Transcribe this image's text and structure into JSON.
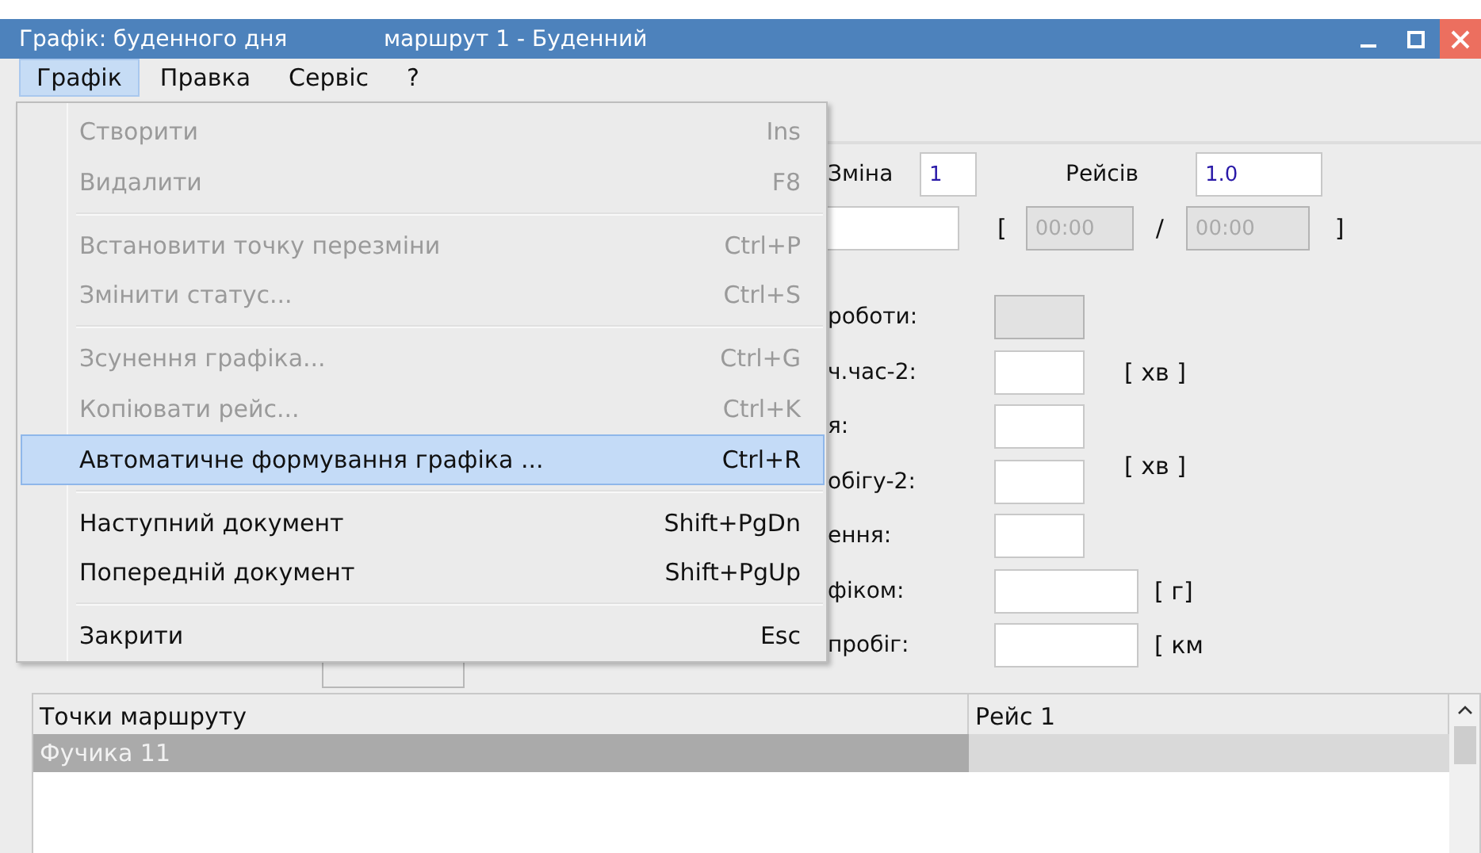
{
  "window": {
    "title": "Графік: буденного дня",
    "subtitle": "маршрут 1 - Буденний"
  },
  "menu_bar": [
    {
      "label": "Графік",
      "selected": true
    },
    {
      "label": "Правка",
      "selected": false
    },
    {
      "label": "Сервіс",
      "selected": false
    },
    {
      "label": "?",
      "selected": false
    }
  ],
  "menu": {
    "groups": [
      [
        {
          "label": "Створити",
          "shortcut": "Ins",
          "disabled": true,
          "selected": false
        },
        {
          "label": "Видалити",
          "shortcut": "F8",
          "disabled": true,
          "selected": false
        }
      ],
      [
        {
          "label": "Встановити точку перезміни",
          "shortcut": "Ctrl+P",
          "disabled": true,
          "selected": false
        },
        {
          "label": "Змінити статус...",
          "shortcut": "Ctrl+S",
          "disabled": true,
          "selected": false
        }
      ],
      [
        {
          "label": "Зсунення графіка...",
          "shortcut": "Ctrl+G",
          "disabled": true,
          "selected": false
        },
        {
          "label": "Копіювати рейс...",
          "shortcut": "Ctrl+K",
          "disabled": true,
          "selected": false
        },
        {
          "label": "Автоматичне формування графіка ...",
          "shortcut": "Ctrl+R",
          "disabled": false,
          "selected": true
        }
      ],
      [
        {
          "label": "Наступний документ",
          "shortcut": "Shift+PgDn",
          "disabled": false,
          "selected": false
        },
        {
          "label": "Попередній документ",
          "shortcut": "Shift+PgUp",
          "disabled": false,
          "selected": false
        }
      ],
      [
        {
          "label": "Закрити",
          "shortcut": "Esc",
          "disabled": false,
          "selected": false
        }
      ]
    ]
  },
  "form": {
    "shift_label": "Зміна",
    "shift_value": "1",
    "trips_label": "Рейсів",
    "trips_value": "1.0",
    "time_open": "[",
    "time_from": "00:00",
    "time_sep": "/",
    "time_to": "00:00",
    "time_close": "]",
    "rows": [
      {
        "label": "роботи:",
        "disabled": true,
        "wide": false,
        "unit": ""
      },
      {
        "label": "ч.час-2:",
        "disabled": false,
        "wide": false,
        "unit": "[ хв ]"
      },
      {
        "label": "я:",
        "disabled": false,
        "wide": false,
        "unit": ""
      },
      {
        "label": "обігу-2:",
        "disabled": false,
        "wide": false,
        "unit": "[ хв ]"
      },
      {
        "label": "ення:",
        "disabled": false,
        "wide": false,
        "unit": ""
      },
      {
        "label": "фіком:",
        "disabled": false,
        "wide": true,
        "unit": "[ г]"
      },
      {
        "label": "пробіг:",
        "disabled": false,
        "wide": true,
        "unit": "[ км"
      }
    ]
  },
  "table": {
    "columns": [
      "Точки маршруту",
      "Рейс 1"
    ],
    "rows": [
      {
        "cells": [
          "Фучика 11",
          ""
        ],
        "selected": true
      }
    ]
  }
}
